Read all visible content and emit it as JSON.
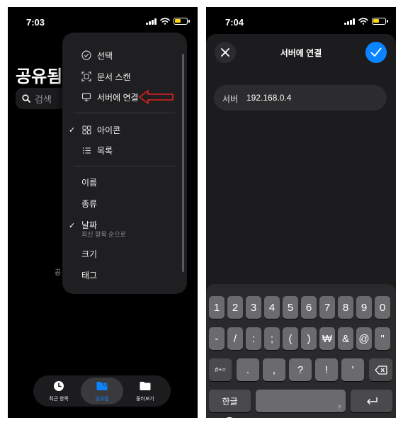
{
  "left": {
    "status_time": "7:03",
    "title": "공유됨",
    "search_placeholder": "검색",
    "background_fragment": "공",
    "menu": {
      "actions": [
        {
          "label": "선택",
          "icon": "checkmark-circle-icon"
        },
        {
          "label": "문서 스캔",
          "icon": "scan-document-icon"
        },
        {
          "label": "서버에 연결",
          "icon": "monitor-icon"
        }
      ],
      "view": [
        {
          "label": "아이콘",
          "icon": "grid-icon",
          "checked": true
        },
        {
          "label": "목록",
          "icon": "list-icon",
          "checked": false
        }
      ],
      "sort": [
        {
          "label": "이름",
          "checked": false
        },
        {
          "label": "종류",
          "checked": false
        },
        {
          "label": "날짜",
          "sublabel": "최신 항목 순으로",
          "checked": true
        },
        {
          "label": "크기",
          "checked": false
        },
        {
          "label": "태그",
          "checked": false
        }
      ],
      "checkmark": "✓",
      "highlight_arrow_color": "#e02020"
    },
    "tabs": [
      {
        "label": "최근 항목",
        "icon": "clock-icon"
      },
      {
        "label": "공유됨",
        "icon": "shared-folder-icon",
        "active": true
      },
      {
        "label": "둘러보기",
        "icon": "folder-icon"
      }
    ]
  },
  "right": {
    "status_time": "7:04",
    "title": "서버에 연결",
    "close_icon": "close-icon",
    "confirm_icon": "checkmark-icon",
    "field_label": "서버",
    "field_value": "192.168.0.4",
    "keyboard": {
      "row1": [
        "1",
        "2",
        "3",
        "4",
        "5",
        "6",
        "7",
        "8",
        "9",
        "0"
      ],
      "row2": [
        "-",
        "/",
        ":",
        ";",
        "(",
        ")",
        "₩",
        "&",
        "@",
        "\""
      ],
      "row3_toggle": "#+=",
      "row3": [
        ".",
        ",",
        "?",
        "!",
        "'"
      ],
      "row3_delete": "delete-icon",
      "lang_key": "한글",
      "space_hint": "한",
      "return_icon": "return-icon",
      "globe_icon": "globe-icon"
    }
  },
  "colors": {
    "accent": "#0a84ff",
    "menu_bg": "#1f1f21",
    "key_bg": "#6b6b6e",
    "battery": "#ffd60a"
  }
}
